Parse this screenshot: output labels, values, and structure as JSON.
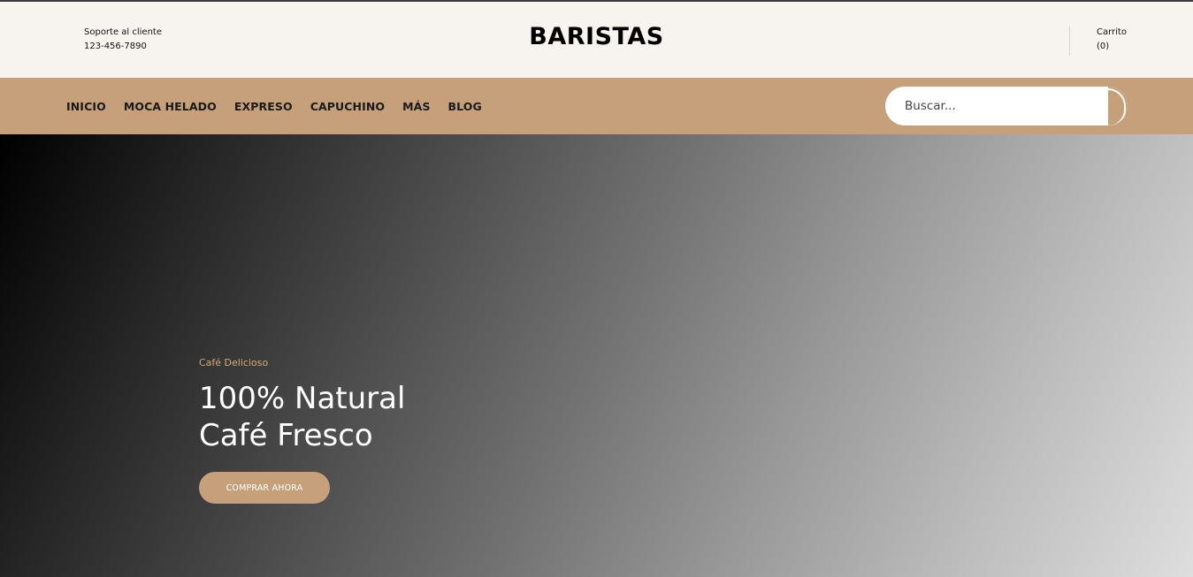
{
  "header": {
    "support_label": "Soporte al cliente",
    "support_phone": "123-456-7890",
    "brand": "BARISTAS",
    "cart_label": "Carrito",
    "cart_count": "(0)"
  },
  "nav": {
    "items": [
      "INICIO",
      "MOCA HELADO",
      "EXPRESO",
      "CAPUCHINO",
      "MÁS",
      "BLOG"
    ]
  },
  "search": {
    "placeholder": "Buscar..."
  },
  "hero": {
    "eyebrow": "Café Delicioso",
    "headline_line1": "100% Natural",
    "headline_line2": "Café Fresco",
    "cta_label": "COMPRAR AHORA"
  },
  "colors": {
    "accent": "#c6a07b",
    "topbar_bg": "#f7f4ef",
    "eyebrow": "#d4a97a"
  }
}
